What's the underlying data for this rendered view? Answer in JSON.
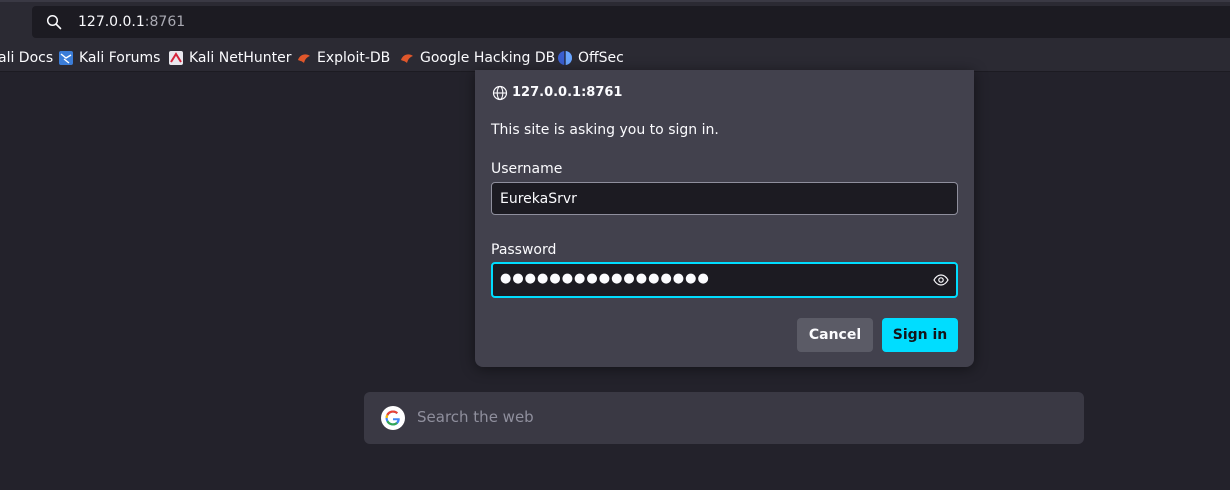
{
  "urlbar": {
    "host": "127.0.0.1",
    "port": ":8761",
    "icon": "search-icon"
  },
  "bookmarks": [
    {
      "label": "ali Docs",
      "icon": "none"
    },
    {
      "label": "Kali Forums",
      "icon": "kali-forums-icon"
    },
    {
      "label": "Kali NetHunter",
      "icon": "kali-nethunter-icon"
    },
    {
      "label": "Exploit-DB",
      "icon": "exploit-db-icon"
    },
    {
      "label": "Google Hacking DB",
      "icon": "ghdb-icon"
    },
    {
      "label": "OffSec",
      "icon": "offsec-icon"
    }
  ],
  "dialog": {
    "origin": "127.0.0.1:8761",
    "message": "This site is asking you to sign in.",
    "username_label": "Username",
    "username_value": "EurekaSrvr",
    "password_label": "Password",
    "password_mask": "●●●●●●●●●●●●●●●●●",
    "cancel_label": "Cancel",
    "signin_label": "Sign in"
  },
  "newtab": {
    "search_placeholder": "Search the web"
  },
  "colors": {
    "accent": "#00ddff",
    "dialog_bg": "#42414d",
    "page_bg": "#23222b"
  }
}
